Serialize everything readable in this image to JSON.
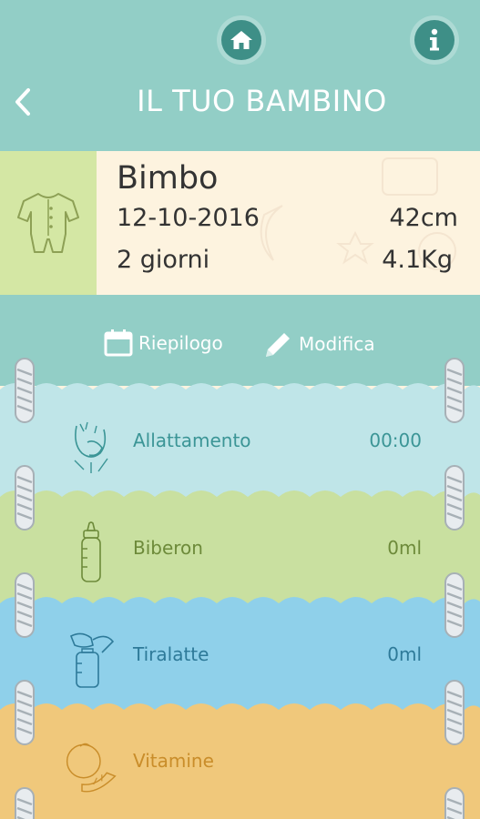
{
  "header": {
    "title": "IL TUO BAMBINO",
    "home_icon": "home-icon",
    "info_icon": "info-icon",
    "back_icon": "chevron-left-icon",
    "color": "#92cec6"
  },
  "baby": {
    "name": "Bimbo",
    "birth_date": "12-10-2016",
    "age": "2 giorni",
    "height": "42cm",
    "weight": "4.1Kg",
    "avatar_icon": "onesie-icon"
  },
  "actions": {
    "summary_label": "Riepilogo",
    "summary_icon": "calendar-icon",
    "edit_label": "Modifica",
    "edit_icon": "pencil-icon"
  },
  "rows": [
    {
      "label": "Allattamento",
      "value": "00:00",
      "icon": "breastfeeding-icon",
      "color": "#bfe5e8"
    },
    {
      "label": "Biberon",
      "value": "0ml",
      "icon": "baby-bottle-icon",
      "color": "#c9e0a0"
    },
    {
      "label": "Tiralatte",
      "value": "0ml",
      "icon": "breast-pump-icon",
      "color": "#8fd0ea"
    },
    {
      "label": "Vitamine",
      "value": "",
      "icon": "orange-icon",
      "color": "#f0c87b"
    }
  ]
}
